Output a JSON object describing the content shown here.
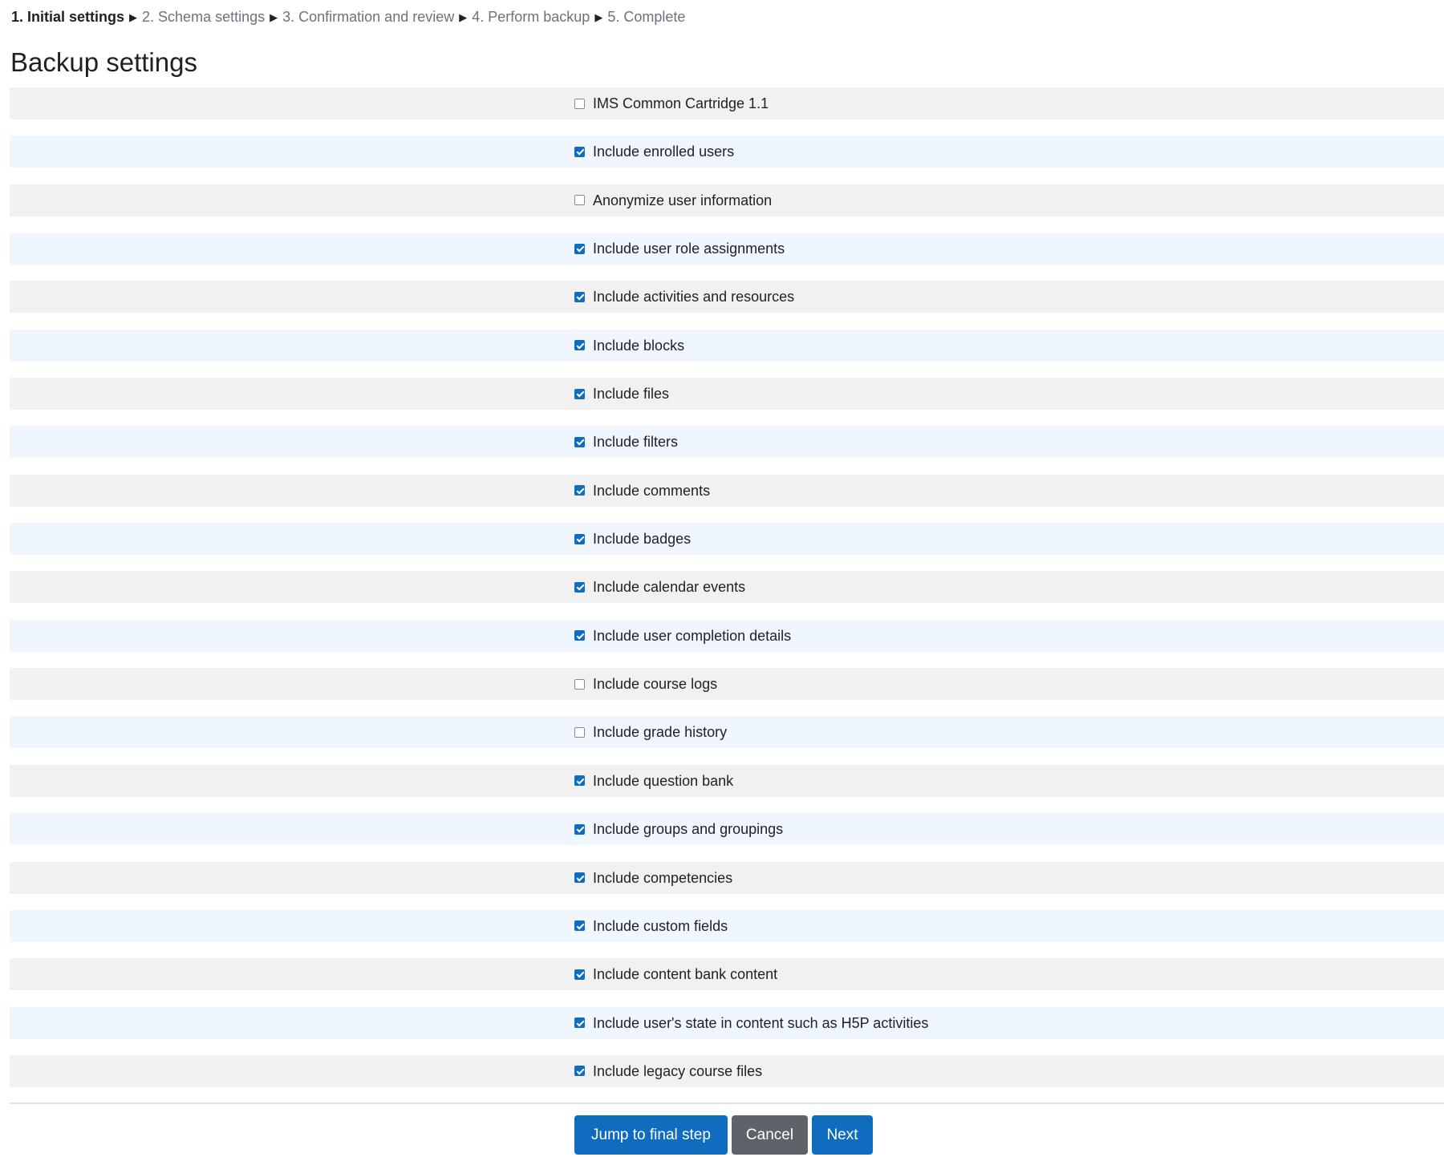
{
  "breadcrumb": {
    "steps": [
      {
        "label": "1. Initial settings",
        "current": true
      },
      {
        "label": "2. Schema settings",
        "current": false
      },
      {
        "label": "3. Confirmation and review",
        "current": false
      },
      {
        "label": "4. Perform backup",
        "current": false
      },
      {
        "label": "5. Complete",
        "current": false
      }
    ],
    "separator": "▶"
  },
  "page": {
    "title": "Backup settings"
  },
  "settings": [
    {
      "label": "IMS Common Cartridge 1.1",
      "checked": false
    },
    {
      "label": "Include enrolled users",
      "checked": true
    },
    {
      "label": "Anonymize user information",
      "checked": false
    },
    {
      "label": "Include user role assignments",
      "checked": true
    },
    {
      "label": "Include activities and resources",
      "checked": true
    },
    {
      "label": "Include blocks",
      "checked": true
    },
    {
      "label": "Include files",
      "checked": true
    },
    {
      "label": "Include filters",
      "checked": true
    },
    {
      "label": "Include comments",
      "checked": true
    },
    {
      "label": "Include badges",
      "checked": true
    },
    {
      "label": "Include calendar events",
      "checked": true
    },
    {
      "label": "Include user completion details",
      "checked": true
    },
    {
      "label": "Include course logs",
      "checked": false
    },
    {
      "label": "Include grade history",
      "checked": false
    },
    {
      "label": "Include question bank",
      "checked": true
    },
    {
      "label": "Include groups and groupings",
      "checked": true
    },
    {
      "label": "Include competencies",
      "checked": true
    },
    {
      "label": "Include custom fields",
      "checked": true
    },
    {
      "label": "Include content bank content",
      "checked": true
    },
    {
      "label": "Include user's state in content such as H5P activities",
      "checked": true
    },
    {
      "label": "Include legacy course files",
      "checked": true
    }
  ],
  "actions": {
    "jump_label": "Jump to final step",
    "cancel_label": "Cancel",
    "next_label": "Next"
  },
  "colors": {
    "primary": "#0f6cbf",
    "secondary": "#5e6369",
    "row_odd": "#f1f1f1",
    "row_even": "#eff6fd"
  }
}
